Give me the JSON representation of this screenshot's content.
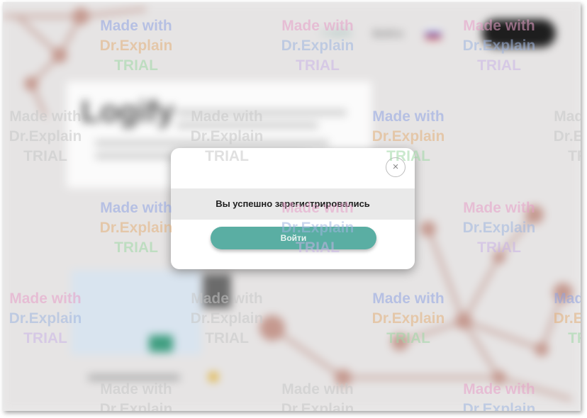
{
  "background": {
    "brand_title": "Logify",
    "nav_brand": "Logify",
    "nav_login": "Войти"
  },
  "modal": {
    "close_glyph": "×",
    "message": "Вы успешно зарегистрировались",
    "login_button_label": "Войти"
  },
  "watermark": {
    "line1": "Made with",
    "line2": "Dr.Explain",
    "line3": "TRIAL"
  },
  "colors": {
    "accent": "#5aaea3",
    "overlay_bg": "#e6e4e4",
    "modal_bg": "#ffffff"
  }
}
